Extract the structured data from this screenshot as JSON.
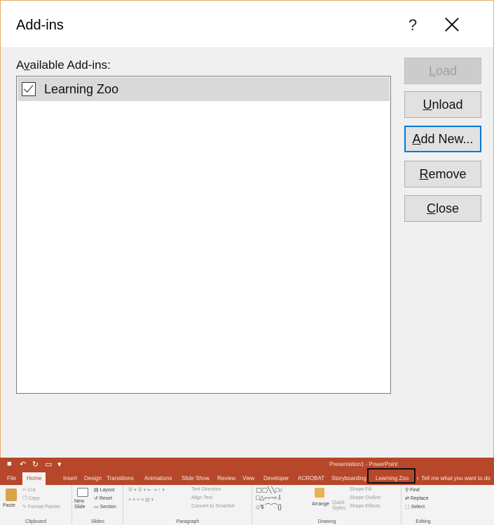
{
  "dialog": {
    "title": "Add-ins",
    "help": "?",
    "list_label_prefix": "A",
    "list_label_mnemonic": "v",
    "list_label_rest": "ailable Add-ins:",
    "addins": [
      {
        "name": "Learning Zoo",
        "checked": true
      }
    ],
    "buttons": {
      "load_mn": "L",
      "load_rest": "oad",
      "unload_mn": "U",
      "unload_rest": "nload",
      "addnew_mn": "A",
      "addnew_rest": "dd New...",
      "remove_mn": "R",
      "remove_rest": "emove",
      "close_mn": "C",
      "close_rest": "lose"
    }
  },
  "ribbon": {
    "doc_title": "Presentation1 - PowerPoint",
    "tabs": {
      "file": "File",
      "home": "Home",
      "insert": "Insert",
      "design": "Design",
      "transitions": "Transitions",
      "animations": "Animations",
      "slideshow": "Slide Show",
      "review": "Review",
      "view": "View",
      "developer": "Developer",
      "acrobat": "ACROBAT",
      "storyboarding": "Storyboarding",
      "learningzoo": "Learning Zoo"
    },
    "tell_me": "Tell me what you want to do",
    "clipboard": {
      "label": "Clipboard",
      "paste": "Paste",
      "cut": "Cut",
      "copy": "Copy",
      "format_painter": "Format Painter"
    },
    "slides": {
      "label": "Slides",
      "new_slide": "New Slide",
      "layout": "Layout",
      "reset": "Reset",
      "section": "Section"
    },
    "paragraph": {
      "label": "Paragraph",
      "text_direction": "Text Direction",
      "align_text": "Align Text",
      "convert": "Convert to SmartArt"
    },
    "drawing": {
      "label": "Drawing",
      "arrange": "Arrange",
      "quick_styles": "Quick Styles",
      "shape_fill": "Shape Fill",
      "shape_outline": "Shape Outline",
      "shape_effects": "Shape Effects"
    },
    "editing": {
      "label": "Editing",
      "find": "Find",
      "replace": "Replace",
      "select": "Select"
    }
  }
}
